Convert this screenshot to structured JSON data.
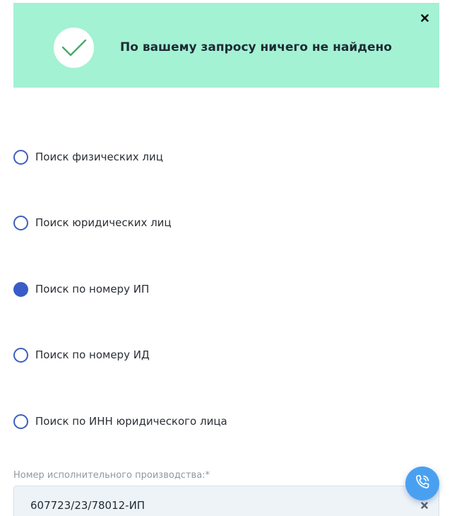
{
  "colors": {
    "banner_bg": "#a3f2d3",
    "check": "#4aa86a",
    "radio_accent": "#3a5cc9",
    "call_button": "#4aa0f0"
  },
  "notification": {
    "icon": "check-icon",
    "message": "По вашему запросу ничего не найдено",
    "close_icon": "close-icon"
  },
  "search_type": {
    "options": [
      {
        "label": "Поиск физических лиц",
        "checked": false
      },
      {
        "label": "Поиск юридических лиц",
        "checked": false
      },
      {
        "label": "Поиск по номеру ИП",
        "checked": true
      },
      {
        "label": "Поиск по номеру ИД",
        "checked": false
      },
      {
        "label": "Поиск по ИНН юридического лица",
        "checked": false
      }
    ]
  },
  "proceeding_field": {
    "label": "Номер исполнительного производства:*",
    "value": "607723/23/78012-ИП",
    "clear_icon": "clear-icon"
  },
  "call_button": {
    "icon": "phone-icon"
  }
}
